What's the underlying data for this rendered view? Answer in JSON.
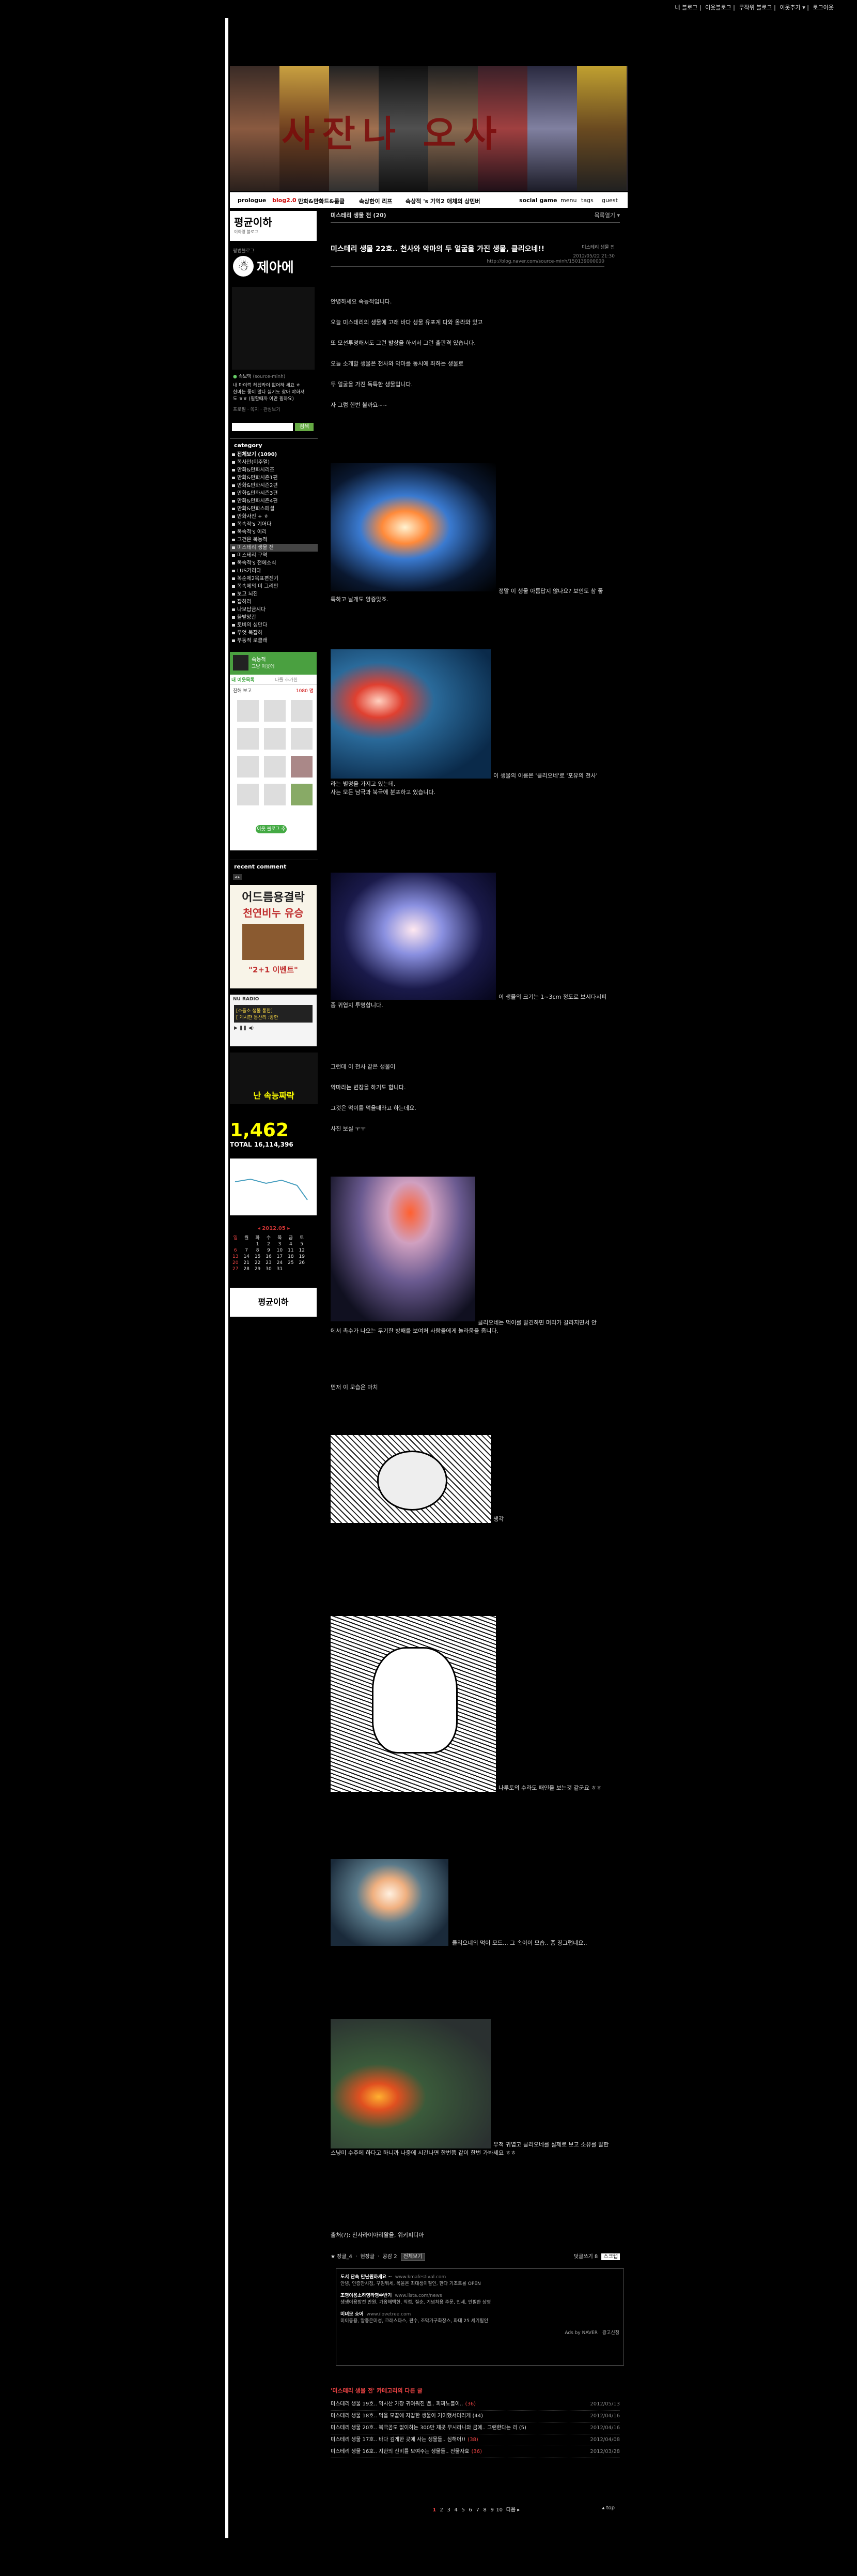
{
  "topnav": {
    "items": [
      "내 블로그",
      "이웃블로그",
      "무작위 블로그",
      "이웃추가 ▾",
      "로그아웃"
    ]
  },
  "banner": {
    "title": "사잔나 오사"
  },
  "navbar": {
    "items": [
      "prologue",
      "blog2.0",
      "만화&만화드&룹클",
      "속상한이 리프",
      "속상적 's 기억2",
      "애체의 상민버",
      "social game",
      "menu",
      "tags",
      "guest"
    ]
  },
  "sidebar": {
    "logo": "평균이하",
    "logo_sub": "이하영 블로그",
    "blog_label": "평범블로그",
    "author_name": "제아에",
    "profile_name": "속보택",
    "profile_id": "(source-minh)",
    "profile_desc": "내 마이럭 헤겠라이 없어하 세요 ㅎ 한마는 좋이 많다 싫기도 찾아 야하셔도 ㅎㅎ (필할때까 이만 필하요)",
    "profile_links": "프로필 · 쪽지 · 관심보기",
    "search_button": "검색",
    "category_title": "category",
    "category_total": "전체보기 (1090)",
    "categories": [
      "복사만(미주얼)",
      "만화&만화시리즈",
      "만화&만화시즌1편",
      "만화&만화시즌2편",
      "만화&만화시즌3편",
      "만화&만화시즌4편",
      "만화&만화스페셜",
      "만화사진 + ㅎ",
      "복속적's 기어다",
      "복속적's 이리",
      "그건은 복능적",
      "미스테리 생물 전",
      "미스테리 구역",
      "복속적's 전에소식",
      "LUS가리다",
      "복순제2목표편진기",
      "복속제의 미 그리판",
      "보고 뇌진",
      "잡하리",
      "나보답금시다",
      "블밭망간",
      "토비의 심만다",
      "무엇 복잡하",
      "부동적 로클래"
    ],
    "selected_category": "미스테리 생물 전",
    "visitor_widget_title": "속능적",
    "visitor_widget_sub": "그냥 이웃에",
    "neighbor_tabs": [
      "내 이웃목록",
      "나를 추가한"
    ],
    "neighbor_label": "친해 보고",
    "neighbor_count": "1080 명",
    "neighbor_more": "이웃 블로그 추가",
    "recent_comment_title": "recent comment",
    "ad_title": "어드름용결락",
    "ad_line2": "천연비누 유승",
    "ad_badge": "\"2+1 이벤트\"",
    "radio_title": "[소듬소 생물 통한]",
    "radio_sub": "[ 게시판 동산리 :방한",
    "radio_label": "NU RADIO",
    "yellow_banner": "난 속능짜략",
    "visitor_today": "1,462",
    "visitor_total": "TOTAL 16,114,396",
    "calendar_title": "2012.05",
    "calendar_rows": [
      [
        "일",
        "월",
        "화",
        "수",
        "목",
        "금",
        "토"
      ],
      [
        "",
        "",
        "1",
        "2",
        "3",
        "4",
        "5"
      ],
      [
        "6",
        "7",
        "8",
        "9",
        "10",
        "11",
        "12"
      ],
      [
        "13",
        "14",
        "15",
        "16",
        "17",
        "18",
        "19"
      ],
      [
        "20",
        "21",
        "22",
        "23",
        "24",
        "25",
        "26"
      ],
      [
        "27",
        "28",
        "29",
        "30",
        "31",
        "",
        ""
      ]
    ],
    "bottom_logo": "평균이하"
  },
  "post": {
    "category_label": "미스테리 생물 전 (20)",
    "list_toggle": "목록열기 ▾",
    "title": "미스테리 생물 22호.. 천사와 악마의 두 얼굴을 가진 생물, 클리오네!!",
    "category_tag": "미스테리 생물 전",
    "date": "2012/05/22 21:30",
    "url": "http://blog.naver.com/source-minh/150139000000",
    "intro": [
      "안녕하세요 속능적입니다.",
      "오늘 미스테리의 생물에 고래 바다 생물 유포계 다와 올라와 있고",
      "또 모선투명해서도 그런 발상을 하셔서 그런 출판격 있습니다.",
      "오늘 소개할 생물은 천사와 악마를 동시에 좌하는 생물로",
      "두 얼굴을 가진 독특한 생물입니다.",
      "자 그럼 한번 볼까요~~"
    ],
    "caption1": "정말 이 생물 아름답지 않나요? 보인도 참 좋",
    "caption1b": "특하고 날개도 앙증맞죠.",
    "caption2": "이 생물의 이름은 '클리오네'로 '포유의 천사'",
    "caption2b": "라는 별명을 가지고 있는데,",
    "caption2c": "사는 모든 남극과 북극에 분포하고 있습니다.",
    "caption3": "이 생물의 크기는 1~3cm 정도로 보시다시피",
    "caption3b": "좀 귀엽지 투명합니다.",
    "mid_text": [
      "그런데 이 천사 같은 생물이",
      "악마라는 변장을 하기도 합니다.",
      "그것은 먹이를 먹을때라고 하는데요.",
      "사진 보실 ㅜㅜ"
    ],
    "caption4": "클리오네는 먹이를 발견하면 머리가 갈라지면서 안",
    "caption4b": "에서 촉수가 나오는 무기한 방패를 보여처 사람들에게 놀라움을 줍니다.",
    "text5": "먼저 이 모습은 마치",
    "caption6": "생각",
    "caption7": "나루토의 수라도 패인을 보는것 같군요 ㅎㅎ",
    "caption8": "클리오네의 먹이 모드... 그 속이이 모습.. 좀 징그럽네요..",
    "caption9": "무척 귀엽고 클리오네를 실제로 보고 소유를 말한",
    "caption9b": "스냥미 수주에 하다고 하니까 나중에 시간나면 한번쯤 같이 한번 가봐세요 ㅎㅎ",
    "source": "출처(?): 천사라이아리왈을, 위키피디아",
    "meta_left": "★ 장굴_4 ㆍ 현장글 ㆍ 공감 2",
    "meta_button": "전체보기",
    "meta_right": "덧글쓰기 8",
    "meta_right_btn": "스크랩",
    "ads": [
      {
        "title": "도서 단속 만난원하세요 ~",
        "url": "www.kmafestival.com",
        "desc": "안녕, 인증만시점, 꾸임뭐세, 목을은 최대생이질인, 한다 기조트를 OPEN"
      },
      {
        "title": "조영이용소하영라영수반기",
        "url": "www.ilsta.com/news",
        "desc": "생생이용방전 만원, 가옵해택한, 직접, 질순, 기념처용 주문, 인세, 인필한 상영"
      },
      {
        "title": "미녀모 쇼어",
        "url": "www.ilovetree.com",
        "desc": "미이동용, 말종은미성, 크래스타스, 판수, 조막가구화장스, 화대 25 세기필인"
      }
    ],
    "ads_by": "Ads by NAVER",
    "ads_apply": "광고신청",
    "related_title": "'미스테리 생물 전' 카테고리의 다른 글",
    "related": [
      {
        "title": "미스테리 생물 19호.. 역시산 가장 귀여워진 뱀.. 피짜노블이..",
        "count": "(36)",
        "date": "2012/05/13"
      },
      {
        "title": "미스테리 생물 18호.. 먹을 모끝에 자갑한 생물이 기이했서더리게 (44)",
        "count": "",
        "date": "2012/04/16"
      },
      {
        "title": "미스테리 생물 20호.. 북극곰도 없이하는 300만 제곳 무시라니와 곰에.. 그런한다는 리 (5)",
        "count": "",
        "date": "2012/04/16"
      },
      {
        "title": "미스테리 생물 17호.. 바다 깊게한 곳에 사는 생물들.. 심해어!!",
        "count": "(38)",
        "date": "2012/04/08"
      },
      {
        "title": "미스테리 생물 16호.. 지한의 신비를 보여주는 생물들.. 전물자효",
        "count": "(36)",
        "date": "2012/03/28"
      }
    ],
    "pages": [
      "1",
      "2",
      "3",
      "4",
      "5",
      "6",
      "7",
      "8",
      "9",
      "10"
    ],
    "next_label": "다음 ▸",
    "top_label": "▴ top"
  }
}
